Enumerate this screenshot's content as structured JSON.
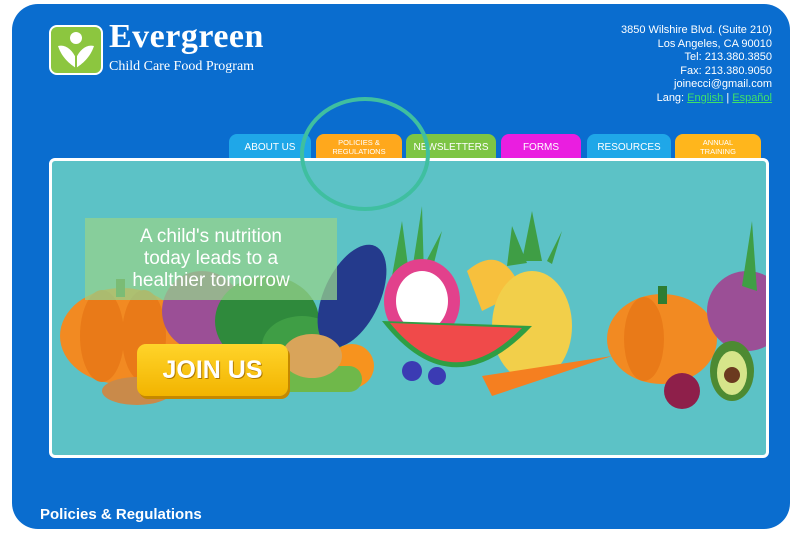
{
  "brand": {
    "title": "Evergreen",
    "subtitle": "Child Care Food Program"
  },
  "contact": {
    "address1": "3850 Wilshire Blvd. (Suite 210)",
    "address2": "Los Angeles, CA 90010",
    "tel": "Tel: 213.380.3850",
    "fax": "Fax: 213.380.9050",
    "email": "joinecci@gmail.com",
    "lang_label": "Lang:",
    "lang_english": "English",
    "lang_separator": "|",
    "lang_spanish": "Español"
  },
  "nav": {
    "tabs": [
      {
        "label": "ABOUT US",
        "color": "#1fa7e8"
      },
      {
        "label_line1": "POLICIES &",
        "label_line2": "REGULATIONS",
        "color": "#ffa81c"
      },
      {
        "label": "NEWSLETTERS",
        "color": "#7dc544"
      },
      {
        "label": "FORMS",
        "color": "#ea1ee0"
      },
      {
        "label": "RESOURCES",
        "color": "#1fa7e8"
      },
      {
        "label_line1": "ANNUAL",
        "label_line2": "TRAINING",
        "color": "#ffb61c"
      }
    ]
  },
  "hero": {
    "tagline_line1": "A child's nutrition",
    "tagline_line2": "today leads to a",
    "tagline_line3": "healthier tomorrow",
    "cta": "JOIN US"
  },
  "page": {
    "heading": "Policies & Regulations"
  },
  "colors": {
    "page_bg": "#0a6dcf",
    "hero_bg": "#5cc2c6",
    "highlight_circle": "#3fbfa0",
    "link_green": "#3ee06a"
  }
}
